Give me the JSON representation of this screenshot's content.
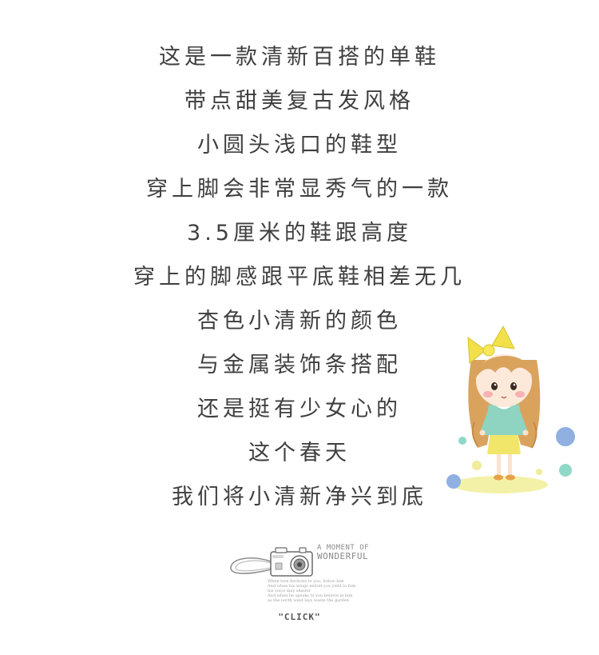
{
  "poem": {
    "lines": [
      "这是一款清新百搭的单鞋",
      "带点甜美复古发风格",
      "小圆头浅口的鞋型",
      "穿上脚会非常显秀气的一款",
      "3.5厘米的鞋跟高度",
      "穿上的脚感跟平底鞋相差无几",
      "杏色小清新的颜色",
      "与金属装饰条搭配",
      "还是挺有少女心的",
      "这个春天",
      "我们将小清新净兴到底"
    ]
  },
  "logo": {
    "title_line1": "A MOMENT OF",
    "title_line2": "WONDERFUL",
    "tagline": [
      "When love beckons to you, follow him",
      "And when his wings enfold you yield to him",
      "his voice may shatter",
      "And when he speaks to you believe in him",
      "as the north wind lays waste the garden"
    ],
    "click": "\"CLICK\""
  },
  "colors": {
    "text": "#3f3f3f",
    "bow": "#f2e04b",
    "hair": "#d9a35e",
    "blouse": "#8fd3c1",
    "skirt": "#f2e66a",
    "dot_blue": "#8fb0e0",
    "dot_teal": "#8fd8c8",
    "dot_yellow": "#f0ec9a"
  },
  "icons": {
    "illustration": "cartoon-girl-illustration",
    "logo": "camera-icon"
  }
}
